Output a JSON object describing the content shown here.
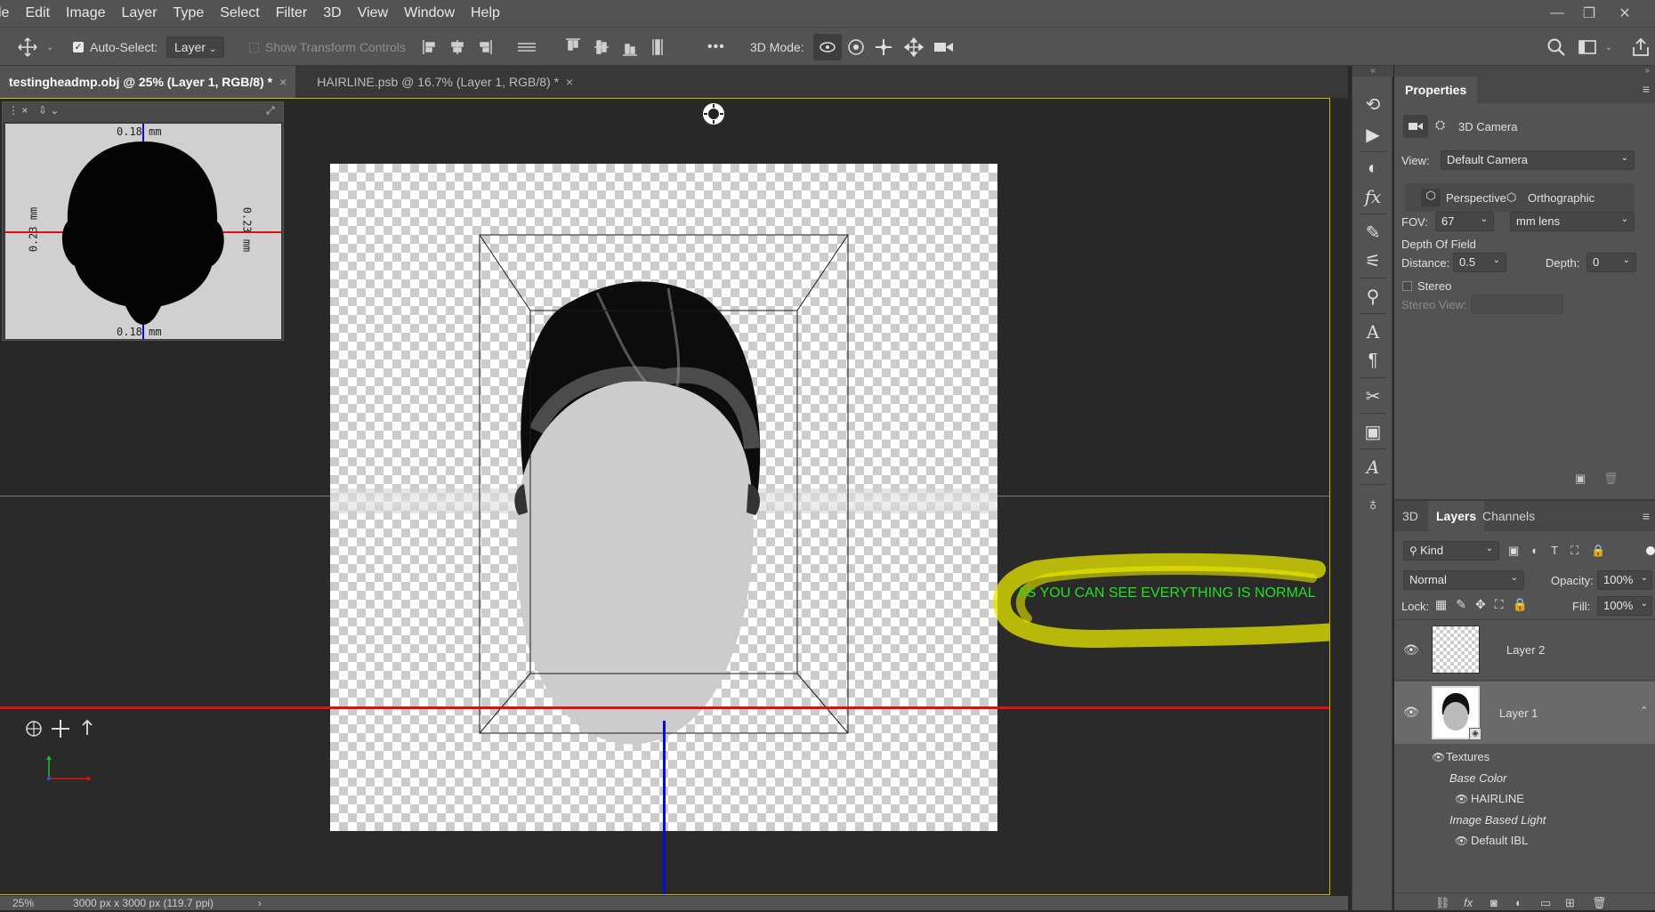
{
  "menu": [
    "le",
    "Edit",
    "Image",
    "Layer",
    "Type",
    "Select",
    "Filter",
    "3D",
    "View",
    "Window",
    "Help"
  ],
  "window_controls": {
    "minimize": "—",
    "restore": "❐",
    "close": "✕"
  },
  "options": {
    "auto_select_label": "Auto-Select:",
    "auto_select_value": "Layer",
    "show_transform_label": "Show Transform Controls",
    "more": "•••",
    "mode_label": "3D Mode:"
  },
  "tabs": [
    {
      "label": "testingheadmp.obj @ 25% (Layer 1, RGB/8) *",
      "close": "×"
    },
    {
      "label": "HAIRLINE.psb @ 16.7% (Layer 1, RGB/8) *",
      "close": "×"
    }
  ],
  "secondary_view": {
    "top_dim": "0.18 mm",
    "bottom_dim": "0.18 mm",
    "left_dim": "0.23 mm",
    "right_dim": "0.23 mm"
  },
  "annotation": "AS YOU CAN SEE EVERYTHING IS NORMAL",
  "status": {
    "zoom": "25%",
    "doc_info": "3000 px x 3000 px (119.7 ppi)",
    "arrow": "›"
  },
  "properties": {
    "title": "Properties",
    "section": "3D Camera",
    "view_label": "View:",
    "view_value": "Default Camera",
    "perspective": "Perspective",
    "orthographic": "Orthographic",
    "fov_label": "FOV:",
    "fov_value": "67",
    "lens_value": "mm lens",
    "dof_label": "Depth Of Field",
    "distance_label": "Distance:",
    "distance_value": "0.5",
    "depth_label": "Depth:",
    "depth_value": "0",
    "stereo_label": "Stereo",
    "stereo_view_label": "Stereo View:"
  },
  "layers_panel": {
    "tabs": [
      "3D",
      "Layers",
      "Channels"
    ],
    "kind_label": "Kind",
    "blend_mode": "Normal",
    "opacity_label": "Opacity:",
    "opacity_value": "100%",
    "lock_label": "Lock:",
    "fill_label": "Fill:",
    "fill_value": "100%",
    "layers": [
      {
        "name": "Layer 2"
      },
      {
        "name": "Layer 1"
      }
    ],
    "sub_items": {
      "textures": "Textures",
      "base_color": "Base Color",
      "hairline": "HAIRLINE",
      "ibl": "Image Based Light",
      "default_ibl": "Default IBL"
    }
  },
  "colors": {
    "accent_yellow": "#c9b800",
    "highlight": "#e8e800",
    "annotation_text": "#22e022",
    "axis_red": "#e01010",
    "axis_blue": "#0a0ad8"
  }
}
